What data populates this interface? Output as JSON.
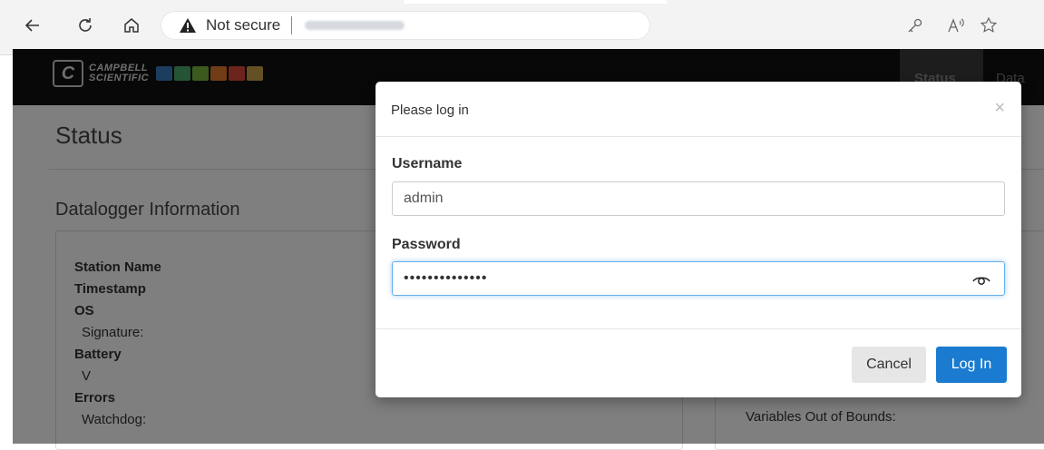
{
  "browser": {
    "security_label": "Not secure"
  },
  "header": {
    "brand_line1": "CAMPBELL",
    "brand_line2": "SCIENTIFIC",
    "menu": [
      {
        "label": "Status",
        "active": true
      },
      {
        "label": "Data",
        "active": false
      }
    ]
  },
  "page": {
    "title": "Status",
    "section_title": "Datalogger Information",
    "info": {
      "station_name": "Station Name",
      "timestamp": "Timestamp",
      "os": "OS",
      "signature": "Signature:",
      "battery": "Battery",
      "battery_unit": "V",
      "errors": "Errors",
      "watchdog": "Watchdog:"
    },
    "right_card_text": "Variables Out of Bounds:"
  },
  "modal": {
    "title": "Please log in",
    "close_glyph": "×",
    "username_label": "Username",
    "username_value": "admin",
    "password_label": "Password",
    "password_masked": "••••••••••••••",
    "cancel_label": "Cancel",
    "login_label": "Log In"
  },
  "colors": {
    "login_button": "#1a7bd0",
    "header_bg": "#111111",
    "focus_border": "#66afe9"
  }
}
